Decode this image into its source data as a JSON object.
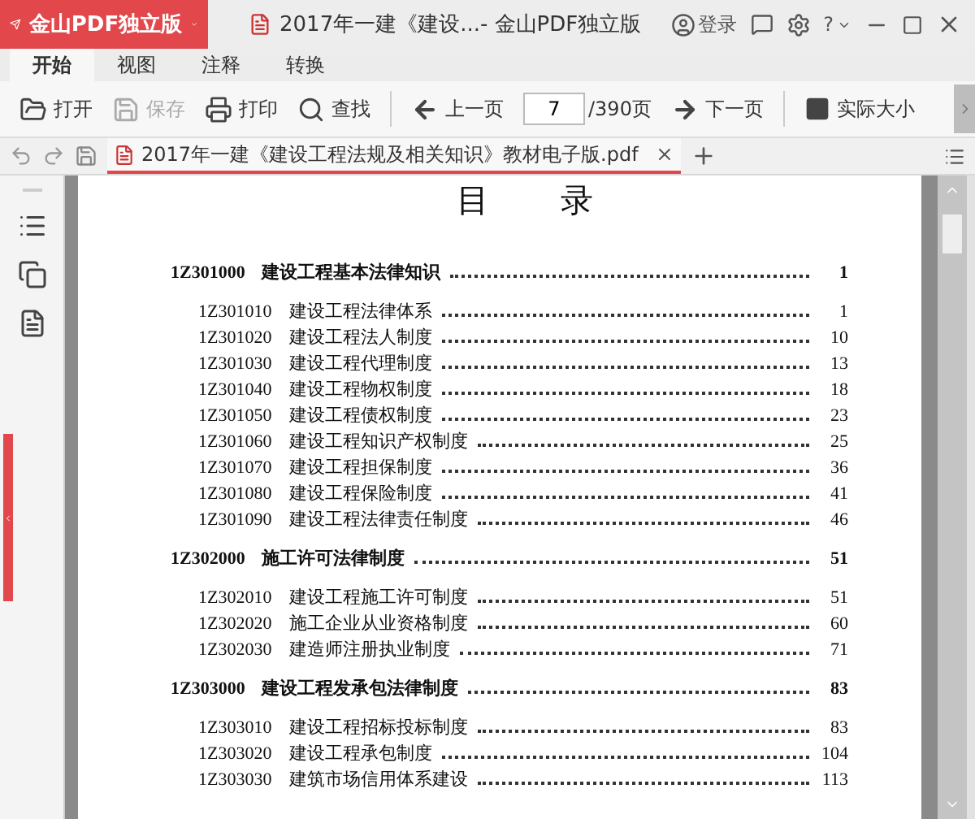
{
  "app": {
    "brand": "金山PDF独立版",
    "title": "2017年一建《建设...- 金山PDF独立版",
    "login": "登录",
    "help": "?"
  },
  "ribbon_tabs": [
    {
      "label": "开始",
      "selected": true
    },
    {
      "label": "视图",
      "selected": false
    },
    {
      "label": "注释",
      "selected": false
    },
    {
      "label": "转换",
      "selected": false
    }
  ],
  "toolbar": {
    "buttons": [
      {
        "kind": "open",
        "label": "打开",
        "disabled": false
      },
      {
        "kind": "save",
        "label": "保存",
        "disabled": true
      },
      {
        "kind": "print",
        "label": "打印",
        "disabled": false
      },
      {
        "kind": "find",
        "label": "查找",
        "disabled": false
      }
    ],
    "prev": "上一页",
    "page": "7",
    "page_total": "/390页",
    "next": "下一页",
    "actual_size": "实际大小"
  },
  "doc_tabs": [
    {
      "label": "2017年一建《建设工程法规及相关知识》教材电子版.pdf",
      "selected": true
    }
  ],
  "page": {
    "heading": [
      "目",
      "录"
    ],
    "toc": [
      {
        "code": "1Z301000",
        "title": "建设工程基本法律知识",
        "page": "1",
        "children": [
          {
            "code": "1Z301010",
            "title": "建设工程法律体系",
            "page": "1"
          },
          {
            "code": "1Z301020",
            "title": "建设工程法人制度",
            "page": "10"
          },
          {
            "code": "1Z301030",
            "title": "建设工程代理制度",
            "page": "13"
          },
          {
            "code": "1Z301040",
            "title": "建设工程物权制度",
            "page": "18"
          },
          {
            "code": "1Z301050",
            "title": "建设工程债权制度",
            "page": "23"
          },
          {
            "code": "1Z301060",
            "title": "建设工程知识产权制度",
            "page": "25"
          },
          {
            "code": "1Z301070",
            "title": "建设工程担保制度",
            "page": "36"
          },
          {
            "code": "1Z301080",
            "title": "建设工程保险制度",
            "page": "41"
          },
          {
            "code": "1Z301090",
            "title": "建设工程法律责任制度",
            "page": "46"
          }
        ]
      },
      {
        "code": "1Z302000",
        "title": "施工许可法律制度",
        "page": "51",
        "children": [
          {
            "code": "1Z302010",
            "title": "建设工程施工许可制度",
            "page": "51"
          },
          {
            "code": "1Z302020",
            "title": "施工企业从业资格制度",
            "page": "60"
          },
          {
            "code": "1Z302030",
            "title": "建造师注册执业制度",
            "page": "71"
          }
        ]
      },
      {
        "code": "1Z303000",
        "title": "建设工程发承包法律制度",
        "page": "83",
        "children": [
          {
            "code": "1Z303010",
            "title": "建设工程招标投标制度",
            "page": "83"
          },
          {
            "code": "1Z303020",
            "title": "建设工程承包制度",
            "page": "104"
          },
          {
            "code": "1Z303030",
            "title": "建筑市场信用体系建设",
            "page": "113"
          }
        ]
      }
    ]
  }
}
